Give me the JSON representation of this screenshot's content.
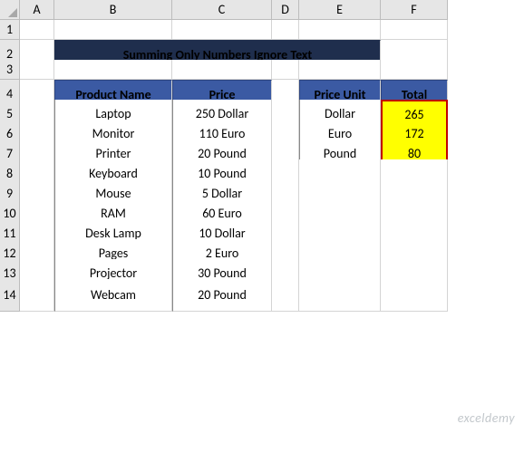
{
  "columns": [
    "",
    "A",
    "B",
    "C",
    "D",
    "E",
    "F"
  ],
  "rows": [
    "1",
    "2",
    "3",
    "4",
    "5",
    "6",
    "7",
    "8",
    "9",
    "10",
    "11",
    "12",
    "13",
    "14"
  ],
  "title": "Summing Only Numbers Ignore Text",
  "table_main": {
    "headers": [
      "Product Name",
      "Price"
    ],
    "data": [
      {
        "name": "Laptop",
        "price": "250 Dollar"
      },
      {
        "name": "Monitor",
        "price": "110 Euro"
      },
      {
        "name": "Printer",
        "price": "20 Pound"
      },
      {
        "name": "Keyboard",
        "price": "10 Pound"
      },
      {
        "name": "Mouse",
        "price": "5 Dollar"
      },
      {
        "name": "RAM",
        "price": "60 Euro"
      },
      {
        "name": "Desk Lamp",
        "price": "10 Dollar"
      },
      {
        "name": "Pages",
        "price": "2 Euro"
      },
      {
        "name": "Projector",
        "price": "30 Pound"
      },
      {
        "name": "Webcam",
        "price": "20 Pound"
      }
    ]
  },
  "table_summary": {
    "headers": [
      "Price Unit",
      "Total"
    ],
    "data": [
      {
        "unit": "Dollar",
        "total": "265"
      },
      {
        "unit": "Euro",
        "total": "172"
      },
      {
        "unit": "Pound",
        "total": "80"
      }
    ]
  },
  "watermark": "exceldemy",
  "chart_data": {
    "type": "table",
    "title": "Summing Only Numbers Ignore Text",
    "columns": [
      "Product Name",
      "Price"
    ],
    "rows": [
      [
        "Laptop",
        "250 Dollar"
      ],
      [
        "Monitor",
        "110 Euro"
      ],
      [
        "Printer",
        "20 Pound"
      ],
      [
        "Keyboard",
        "10 Pound"
      ],
      [
        "Mouse",
        "5 Dollar"
      ],
      [
        "RAM",
        "60 Euro"
      ],
      [
        "Desk Lamp",
        "10 Dollar"
      ],
      [
        "Pages",
        "2 Euro"
      ],
      [
        "Projector",
        "30 Pound"
      ],
      [
        "Webcam",
        "20 Pound"
      ]
    ],
    "summary": [
      [
        "Dollar",
        265
      ],
      [
        "Euro",
        172
      ],
      [
        "Pound",
        80
      ]
    ]
  }
}
